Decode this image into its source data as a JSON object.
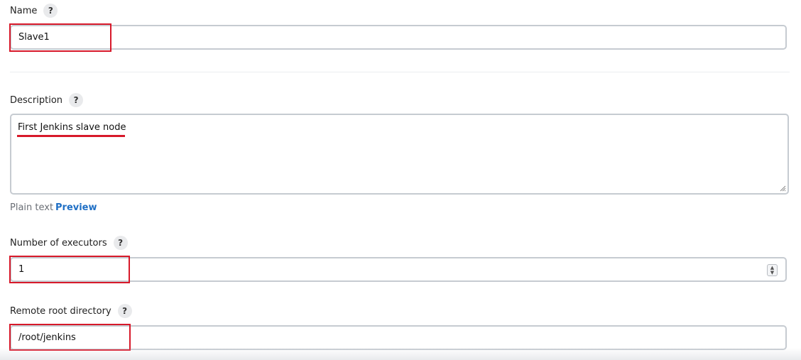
{
  "fields": {
    "name": {
      "label": "Name",
      "help": "?",
      "value": "Slave1"
    },
    "description": {
      "label": "Description",
      "help": "?",
      "value": "First Jenkins slave node",
      "format_plain": "Plain text",
      "format_preview": "Preview"
    },
    "executors": {
      "label": "Number of executors",
      "help": "?",
      "value": "1"
    },
    "remote_root": {
      "label": "Remote root directory",
      "help": "?",
      "value": "/root/jenkins"
    }
  },
  "colors": {
    "highlight": "#d7192a",
    "link": "#1f6fc5",
    "border": "#c6cbd1"
  },
  "icons": {
    "help": "question-mark-icon",
    "spinner": "number-spinner-icon",
    "resize": "resize-grip-icon"
  }
}
